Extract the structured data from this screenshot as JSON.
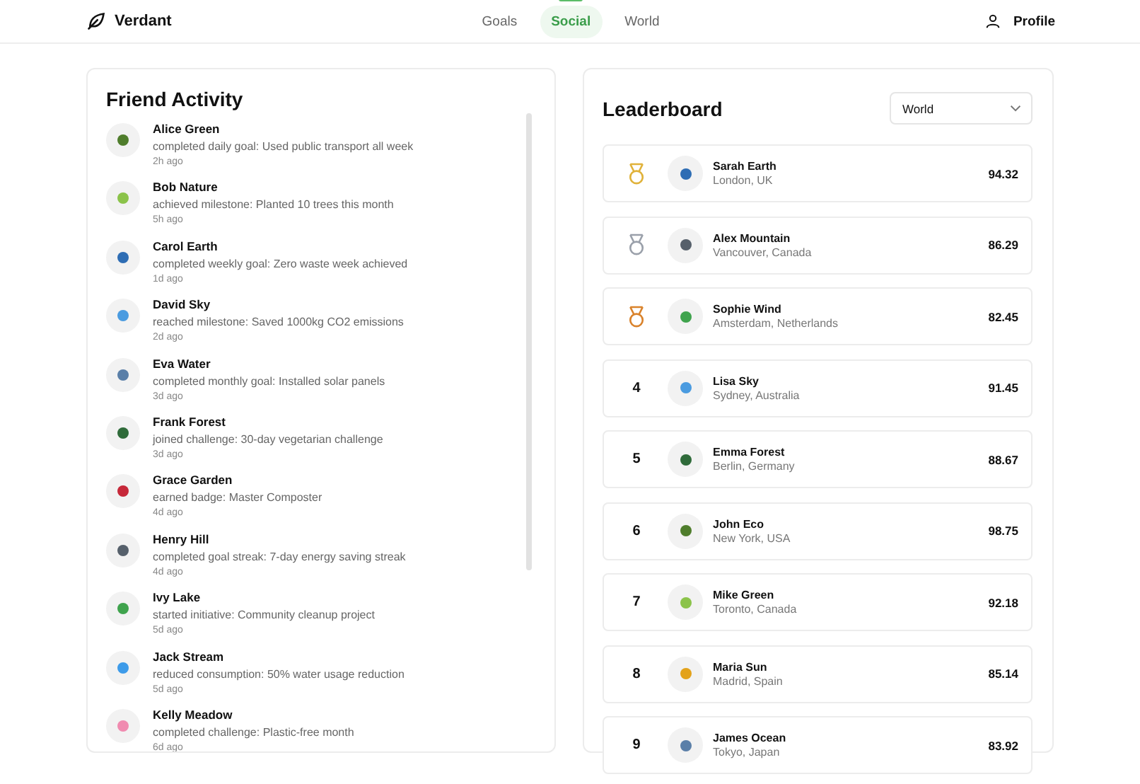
{
  "header": {
    "brand": "Verdant",
    "nav": [
      {
        "label": "Goals",
        "selected": false
      },
      {
        "label": "Social",
        "selected": true
      },
      {
        "label": "World",
        "selected": false
      }
    ],
    "profile": "Profile"
  },
  "activity": {
    "title": "Friend Activity",
    "items": [
      {
        "name": "Alice Green",
        "text": "completed daily goal: Used public transport all week",
        "time": "2h ago",
        "color": "#4f7d2c"
      },
      {
        "name": "Bob Nature",
        "text": "achieved milestone: Planted 10 trees this month",
        "time": "5h ago",
        "color": "#8bc34a"
      },
      {
        "name": "Carol Earth",
        "text": "completed weekly goal: Zero waste week achieved",
        "time": "1d ago",
        "color": "#2e6db4"
      },
      {
        "name": "David Sky",
        "text": "reached milestone: Saved 1000kg CO2 emissions",
        "time": "2d ago",
        "color": "#4a9be0"
      },
      {
        "name": "Eva Water",
        "text": "completed monthly goal: Installed solar panels",
        "time": "3d ago",
        "color": "#5a7fa8"
      },
      {
        "name": "Frank Forest",
        "text": "joined challenge: 30-day vegetarian challenge",
        "time": "3d ago",
        "color": "#2f6b3a"
      },
      {
        "name": "Grace Garden",
        "text": "earned badge: Master Composter",
        "time": "4d ago",
        "color": "#c62839"
      },
      {
        "name": "Henry Hill",
        "text": "completed goal streak: 7-day energy saving streak",
        "time": "4d ago",
        "color": "#56606b"
      },
      {
        "name": "Ivy Lake",
        "text": "started initiative: Community cleanup project",
        "time": "5d ago",
        "color": "#3fa34d"
      },
      {
        "name": "Jack Stream",
        "text": "reduced consumption: 50% water usage reduction",
        "time": "5d ago",
        "color": "#3d9be9"
      },
      {
        "name": "Kelly Meadow",
        "text": "completed challenge: Plastic-free month",
        "time": "6d ago",
        "color": "#f08bb0"
      }
    ]
  },
  "leaderboard": {
    "title": "Leaderboard",
    "filter": "World",
    "rows": [
      {
        "kind": "medal",
        "color": "#e0b23a",
        "name": "Sarah Earth",
        "location": "London, UK",
        "score": "94.32",
        "avatar": {
          "color": "#2e6db4"
        }
      },
      {
        "kind": "medal",
        "color": "#9aa0aa",
        "name": "Alex Mountain",
        "location": "Vancouver, Canada",
        "score": "86.29",
        "avatar": {
          "color": "#56606b"
        }
      },
      {
        "kind": "medal",
        "color": "#d9822b",
        "name": "Sophie Wind",
        "location": "Amsterdam, Netherlands",
        "score": "82.45",
        "avatar": {
          "color": "#3fa34d"
        }
      },
      {
        "kind": "number",
        "rank": "4",
        "name": "Lisa Sky",
        "location": "Sydney, Australia",
        "score": "91.45",
        "avatar": {
          "color": "#4a9be0"
        }
      },
      {
        "kind": "number",
        "rank": "5",
        "name": "Emma Forest",
        "location": "Berlin, Germany",
        "score": "88.67",
        "avatar": {
          "color": "#2f6b3a"
        }
      },
      {
        "kind": "number",
        "rank": "6",
        "name": "John Eco",
        "location": "New York, USA",
        "score": "98.75",
        "avatar": {
          "color": "#4f7d2c"
        }
      },
      {
        "kind": "number",
        "rank": "7",
        "name": "Mike Green",
        "location": "Toronto, Canada",
        "score": "92.18",
        "avatar": {
          "color": "#8bc34a"
        }
      },
      {
        "kind": "number",
        "rank": "8",
        "name": "Maria Sun",
        "location": "Madrid, Spain",
        "score": "85.14",
        "avatar": {
          "color": "#e3a21a"
        }
      },
      {
        "kind": "number",
        "rank": "9",
        "name": "James Ocean",
        "location": "Tokyo, Japan",
        "score": "83.92",
        "avatar": {
          "color": "#5a7fa8"
        }
      }
    ]
  }
}
